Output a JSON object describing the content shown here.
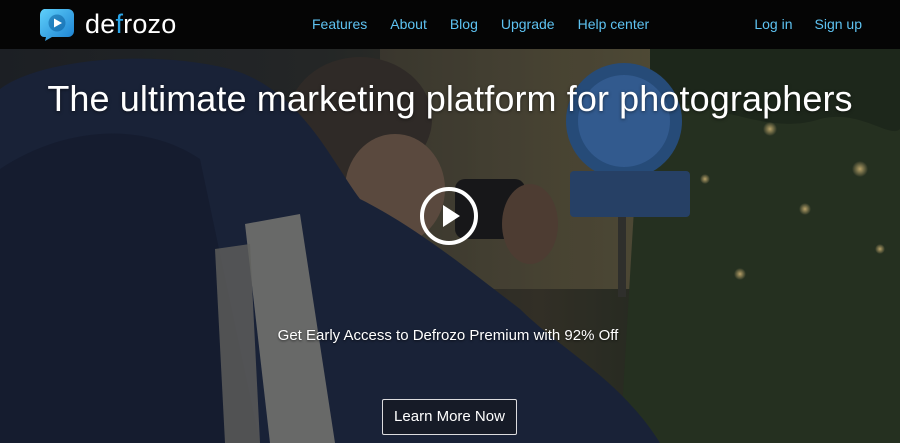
{
  "brand": {
    "name_prefix": "de",
    "name_accent": "f",
    "name_suffix": "rozo",
    "accent_color": "#2aa5e8",
    "logo_icon": "play-bubble-logo-icon"
  },
  "nav": {
    "main": [
      "Features",
      "About",
      "Blog",
      "Upgrade",
      "Help center"
    ],
    "account": [
      "Log in",
      "Sign up"
    ],
    "link_color": "#5ec3f2"
  },
  "hero": {
    "headline": "The ultimate marketing platform for photographers",
    "play_icon": "play-circle-icon",
    "subline": "Get Early Access to Defrozo Premium with 92% Off",
    "cta_label": "Learn More Now"
  }
}
